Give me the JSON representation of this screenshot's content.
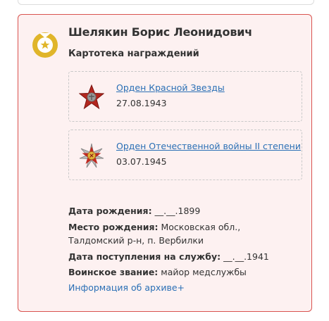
{
  "person": {
    "name": "Шелякин Борис Леонидович",
    "section_title": "Картотека награждений"
  },
  "awards": [
    {
      "title": "Орден Красной Звезды",
      "date": "27.08.1943",
      "icon": "red-star-order-icon"
    },
    {
      "title": "Орден Отечественной войны II степени",
      "date": "03.07.1945",
      "icon": "patriotic-war-order-icon"
    }
  ],
  "details": {
    "birth_date_label": "Дата рождения:",
    "birth_date_value": "__.__.1899",
    "birth_place_label": "Место рождения:",
    "birth_place_value": "Московская обл., Талдомский р-н, п. Вербилки",
    "service_start_label": "Дата поступления на службу:",
    "service_start_value": "__.__.1941",
    "rank_label": "Воинское звание:",
    "rank_value": "майор медслужбы",
    "archive_link": "Информация об архиве+"
  },
  "colors": {
    "card_border": "#d9534f",
    "card_background": "#fdf1f1",
    "link": "#2a6fb5",
    "medal_gold": "#e0b52a"
  }
}
